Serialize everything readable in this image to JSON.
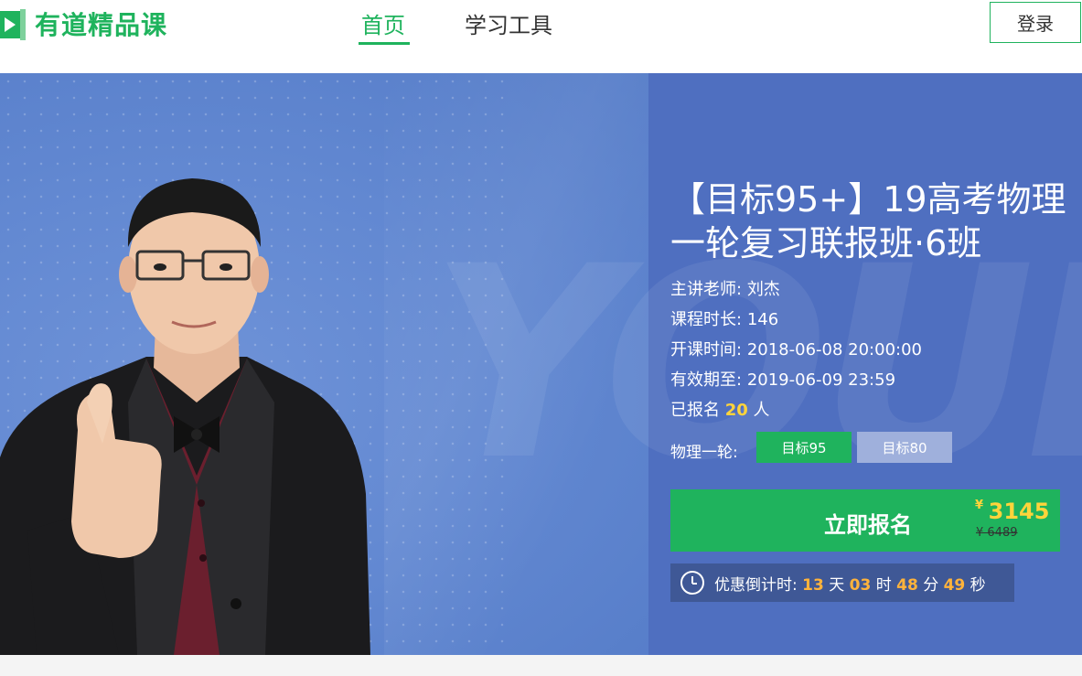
{
  "header": {
    "logo_text": "有道精品课",
    "nav": [
      {
        "label": "首页",
        "active": true
      },
      {
        "label": "学习工具",
        "active": false
      }
    ],
    "login_label": "登录"
  },
  "banner": {
    "watermark": "YOUD",
    "course_title": "【目标95+】19高考物理一轮复习联报班·6班",
    "teacher_label": "主讲老师:",
    "teacher_name": "刘杰",
    "duration_label": "课程时长:",
    "duration_value": "146",
    "start_label": "开课时间:",
    "start_value": "2018-06-08 20:00:00",
    "valid_label": "有效期至:",
    "valid_value": "2019-06-09 23:59",
    "enrolled_prefix": "已报名",
    "enrolled_count": "20",
    "enrolled_suffix": "人",
    "tag_group_label": "物理一轮:",
    "tags": [
      {
        "label": "目标95",
        "active": true
      },
      {
        "label": "目标80",
        "active": false
      }
    ],
    "enroll_label": "立即报名",
    "currency": "¥",
    "price_now": "3145",
    "price_old": "¥ 6489",
    "countdown": {
      "label": "优惠倒计时:",
      "days": "13",
      "days_unit": "天",
      "hours": "03",
      "hours_unit": "时",
      "minutes": "48",
      "minutes_unit": "分",
      "seconds": "49",
      "seconds_unit": "秒"
    }
  },
  "colors": {
    "brand_green": "#1fb35d",
    "banner_blue": "#6187d2",
    "highlight_yellow": "#ffd43b",
    "countdown_orange": "#ffb33b"
  }
}
